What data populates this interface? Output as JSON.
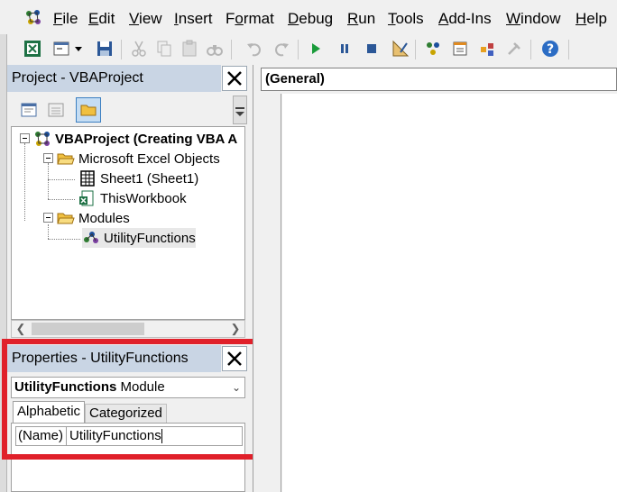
{
  "menu": {
    "items": [
      {
        "underline": "F",
        "rest": "ile"
      },
      {
        "underline": "E",
        "rest": "dit"
      },
      {
        "underline": "V",
        "rest": "iew"
      },
      {
        "underline": "I",
        "rest": "nsert"
      },
      {
        "pre": "F",
        "underline": "o",
        "rest": "rmat"
      },
      {
        "underline": "D",
        "rest": "ebug"
      },
      {
        "underline": "R",
        "rest": "un"
      },
      {
        "underline": "T",
        "rest": "ools"
      },
      {
        "underline": "A",
        "rest": "dd-Ins"
      },
      {
        "underline": "W",
        "rest": "indow"
      },
      {
        "underline": "H",
        "rest": "elp"
      }
    ]
  },
  "project_panel": {
    "title": "Project - VBAProject",
    "tree": {
      "root": "VBAProject (Creating VBA A",
      "excel_objects": "Microsoft Excel Objects",
      "sheet1": "Sheet1 (Sheet1)",
      "this_workbook": "ThisWorkbook",
      "modules": "Modules",
      "utility": "UtilityFunctions"
    }
  },
  "properties_panel": {
    "title": "Properties - UtilityFunctions",
    "object_name": "UtilityFunctions",
    "object_type": " Module",
    "tabs": [
      "Alphabetic",
      "Categorized"
    ],
    "row": {
      "name": "(Name)",
      "value": "UtilityFunctions"
    }
  },
  "code_window": {
    "object_combo": "(General)"
  },
  "colors": {
    "highlight_border": "#e0202a",
    "panel_title_bg": "#c9d5e4"
  }
}
